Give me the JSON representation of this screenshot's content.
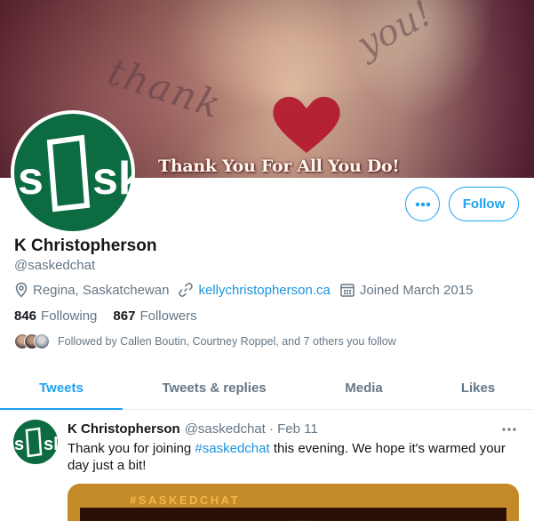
{
  "banner": {
    "caption": "Thank You For All You Do!",
    "script_text": "thank",
    "script_text_2": "you!"
  },
  "avatar": {
    "logo_text": "sask"
  },
  "profile": {
    "more_label": "More",
    "follow_label": "Follow",
    "name": "K Christopherson",
    "handle": "@saskedchat",
    "location": "Regina, Saskatchewan",
    "website": "kellychristopherson.ca",
    "joined": "Joined March 2015",
    "following_count": "846",
    "following_label": "Following",
    "followers_count": "867",
    "followers_label": "Followers",
    "followed_by": "Followed by Callen Boutin, Courtney Roppel, and 7 others you follow"
  },
  "tabs": [
    {
      "label": "Tweets",
      "active": true
    },
    {
      "label": "Tweets & replies",
      "active": false
    },
    {
      "label": "Media",
      "active": false
    },
    {
      "label": "Likes",
      "active": false
    }
  ],
  "tweet": {
    "name": "K Christopherson",
    "handle_date": "@saskedchat · Feb 11",
    "text_before": "Thank you for joining ",
    "hashtag": "#saskedchat",
    "text_after": " this evening. We hope it's warmed your day just a bit!",
    "media_tag": "#SASKEDCHAT"
  },
  "colors": {
    "accent": "#1da1f2",
    "link": "#1b95e0",
    "muted": "#657786",
    "brand_green": "#0c6b41"
  }
}
